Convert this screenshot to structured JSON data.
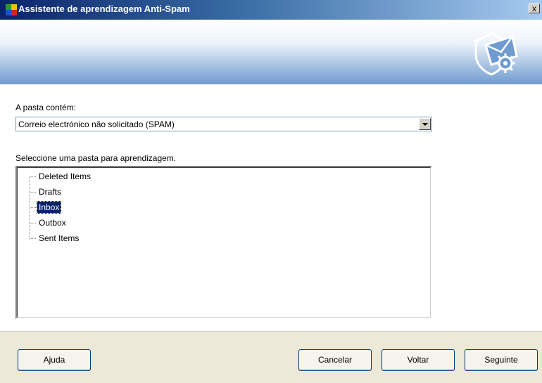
{
  "window": {
    "title": "Assistente de aprendizagem Anti-Spam",
    "close_label": "x"
  },
  "form": {
    "folder_contains_label": "A pasta contém:",
    "folder_contains_value": "Correio electrónico não solicitado (SPAM)",
    "select_folder_label": "Seleccione uma pasta para aprendizagem."
  },
  "tree": {
    "items": [
      {
        "label": "Deleted Items",
        "selected": false
      },
      {
        "label": "Drafts",
        "selected": false
      },
      {
        "label": "Inbox",
        "selected": true
      },
      {
        "label": "Outbox",
        "selected": false
      },
      {
        "label": "Sent Items",
        "selected": false
      }
    ]
  },
  "buttons": {
    "help": "Ajuda",
    "cancel": "Cancelar",
    "back": "Voltar",
    "next": "Seguinte"
  },
  "icons": {
    "app": "avg-logo-icon",
    "banner": "shield-mail-gear-icon",
    "combo_arrow": "chevron-down-icon"
  },
  "colors": {
    "title_bar_start": "#0a246a",
    "selection": "#0a246a",
    "dialog_face": "#ece9d8"
  }
}
